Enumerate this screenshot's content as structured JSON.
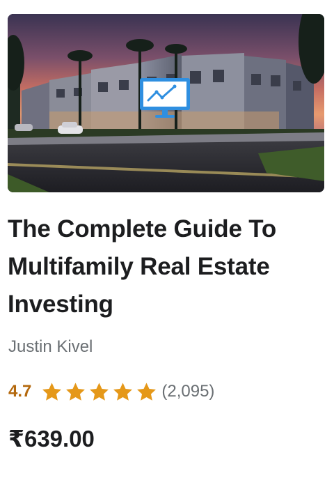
{
  "course": {
    "title": "The Complete Guide To Multifamily Real Estate Investing",
    "instructor": "Justin Kivel",
    "rating": "4.7",
    "rating_fraction": 0.94,
    "rating_count": "(2,095)",
    "price": "₹639.00"
  },
  "thumbnail": {
    "icon": "line-chart-monitor-icon",
    "scene": "townhouses-at-dusk"
  },
  "colors": {
    "star": "#e59819",
    "rating_text": "#b4690e",
    "title_text": "#1c1d1f",
    "muted_text": "#6a6f73",
    "monitor_blue": "#2f8fe0"
  }
}
